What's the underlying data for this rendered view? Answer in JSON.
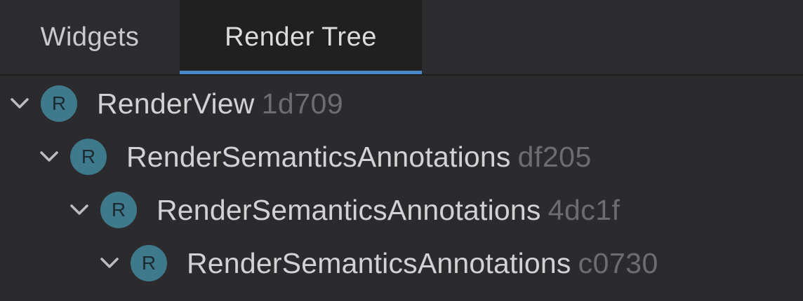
{
  "tabs": [
    {
      "label": "Widgets",
      "active": false
    },
    {
      "label": "Render Tree",
      "active": true
    }
  ],
  "tree": {
    "nodes": [
      {
        "badge": "R",
        "name": "RenderView",
        "id": "1d709",
        "expanded": true
      },
      {
        "badge": "R",
        "name": "RenderSemanticsAnnotations",
        "id": "df205",
        "expanded": true
      },
      {
        "badge": "R",
        "name": "RenderSemanticsAnnotations",
        "id": "4dc1f",
        "expanded": true
      },
      {
        "badge": "R",
        "name": "RenderSemanticsAnnotations",
        "id": "c0730",
        "expanded": true
      }
    ]
  },
  "colors": {
    "active_tab_underline": "#4a88c7",
    "badge_bg": "#3f7a8c",
    "id_text": "#6d6d70"
  },
  "icons": {
    "expand": "chevron-down-icon"
  }
}
